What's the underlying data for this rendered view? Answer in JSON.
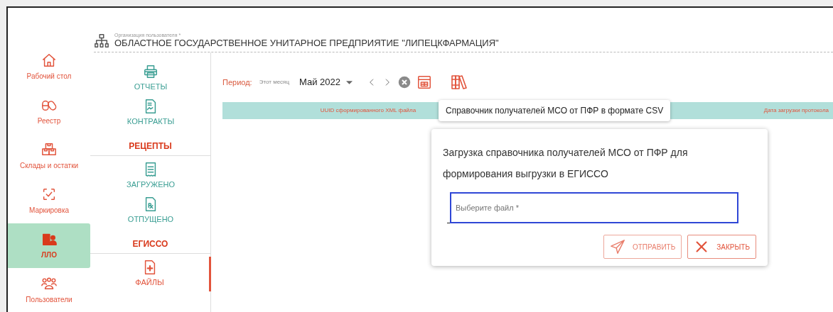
{
  "organization": {
    "label": "Организация пользователя *",
    "name": "ОБЛАСТНОЕ ГОСУДАРСТВЕННОЕ УНИТАРНОЕ ПРЕДПРИЯТИЕ \"ЛИПЕЦКФАРМАЦИЯ\""
  },
  "sidebar": {
    "items": [
      {
        "label": "Рабочий стол",
        "selected": false
      },
      {
        "label": "Реестр",
        "selected": false
      },
      {
        "label": "Склады и остатки",
        "selected": false
      },
      {
        "label": "Маркировка",
        "selected": false
      },
      {
        "label": "ЛЛО",
        "selected": true
      },
      {
        "label": "Пользователи",
        "selected": false
      }
    ]
  },
  "subnav": [
    {
      "kind": "link",
      "label": "ОТЧЕТЫ",
      "selected": false
    },
    {
      "kind": "link",
      "label": "КОНТРАКТЫ",
      "selected": false
    },
    {
      "kind": "heading",
      "label": "РЕЦЕПТЫ"
    },
    {
      "kind": "link",
      "label": "ЗАГРУЖЕНО",
      "selected": false
    },
    {
      "kind": "link",
      "label": "ОТПУЩЕНО",
      "selected": false
    },
    {
      "kind": "heading",
      "label": "ЕГИССО"
    },
    {
      "kind": "link",
      "label": "ФАЙЛЫ",
      "selected": true
    }
  ],
  "toolbar": {
    "period_label": "Период:",
    "period_hint": "Этот месяц",
    "month": "Май 2022"
  },
  "table": {
    "columns": [
      "UUID сформированного XML файла",
      "Дата загрузки протокола"
    ]
  },
  "tooltip": "Справочник получателей МСО от ПФР в формате CSV",
  "dialog": {
    "title": "Загрузка справочника получателей МСО от ПФР для формирования выгрузки в ЕГИССО",
    "file_field": {
      "placeholder": "Выберите файл *"
    },
    "buttons": [
      "ОТПРАВИТЬ",
      "ЗАКРЫТЬ"
    ]
  }
}
